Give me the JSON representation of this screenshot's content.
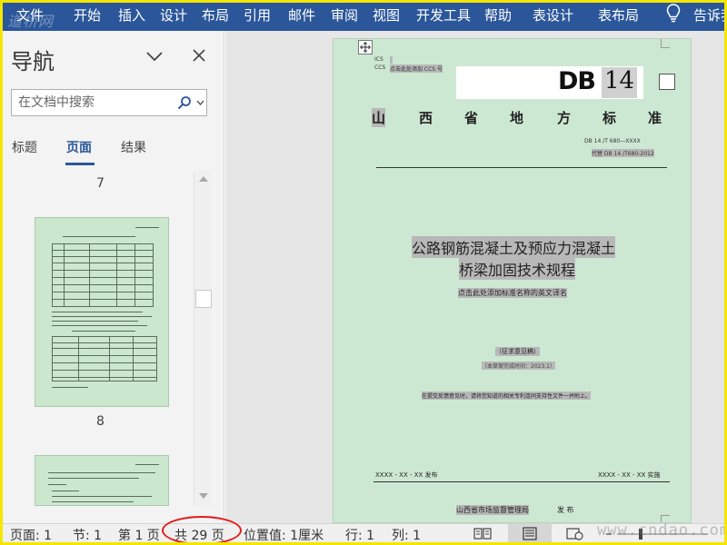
{
  "ribbon": {
    "tabs": [
      "文件",
      "开始",
      "插入",
      "设计",
      "布局",
      "引用",
      "邮件",
      "审阅",
      "视图",
      "开发工具",
      "帮助",
      "表设计",
      "表布局",
      "告诉我"
    ],
    "watermark": "道桥网"
  },
  "nav": {
    "title": "导航",
    "search_placeholder": "在文档中搜索",
    "tabs": [
      "标题",
      "页面",
      "结果"
    ],
    "active_tab": "页面",
    "page_labels": [
      "7",
      "8"
    ]
  },
  "document": {
    "ics": "ICS",
    "ccs": "CCS",
    "ccs_hint": "点击此处添加 CCS 号",
    "db_label": "DB",
    "db_number": "14",
    "province_chars": [
      "山",
      "西",
      "省",
      "地",
      "方",
      "标",
      "准"
    ],
    "std_number": "DB 14 /T 680—XXXX",
    "replaces": "代替 DB 14 /T680-2012",
    "title_line1": "公路钢筋混凝土及预应力混凝土",
    "title_line2": "桥梁加固技术规程",
    "english_hint": "点击此处添加标准名称的英文译名",
    "draft_label": "（征求意见稿）",
    "draft_date": "（本草案完成时间：2023.1）",
    "feedback_note": "在提交反馈意见时，请将您知道的相关专利连同支持性文件一并附上。",
    "publish_date": "XXXX - XX - XX 发布",
    "implement_date": "XXXX - XX - XX 实施",
    "issuer": "山西省市场监督管理局",
    "issue_word": "发 布"
  },
  "status": {
    "page": "页面: 1",
    "section": "节: 1",
    "page_of": "第 1 页",
    "total": "共 29 页",
    "position": "位置值: 1厘米",
    "line": "行: 1",
    "column": "列: 1",
    "watermark": "www.cndao.com"
  },
  "colors": {
    "ribbon": "#2b579a",
    "page_bg": "#cde8d2",
    "frame": "#f5e600",
    "highlight_oval": "#e21b1b"
  }
}
